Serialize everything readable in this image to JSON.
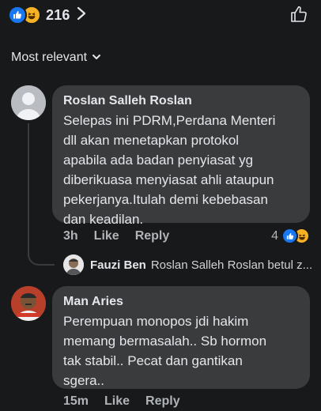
{
  "reactions": {
    "count": "216",
    "types": [
      "like-icon",
      "haha-icon"
    ]
  },
  "sort": {
    "label": "Most relevant"
  },
  "comments": [
    {
      "author": "Roslan Salleh Roslan",
      "text": "Selepas ini PDRM,Perdana Menteri\ndll akan menetapkan protokol\napabila ada badan penyiasat yg\ndiberikuasa menyiasat ahli ataupun\npekerjanya.Itulah demi kebebasan\ndan keadilan.",
      "time": "3h",
      "like": "Like",
      "reply": "Reply",
      "reaction_count": "4",
      "reply_preview": {
        "author": "Fauzi Ben",
        "text": "Roslan Salleh Roslan betul z..."
      }
    },
    {
      "author": "Man Aries",
      "text": "Perempuan monopos jdi hakim\nmemang bermasalah.. Sb hormon\ntak stabil.. Pecat dan gantikan\nsgera..",
      "time": "15m",
      "like": "Like",
      "reply": "Reply"
    }
  ],
  "colors": {
    "background": "#18191a",
    "bubble": "#3a3b3c",
    "like_blue": "#1877f2",
    "haha_yellow": "#f7b125"
  }
}
